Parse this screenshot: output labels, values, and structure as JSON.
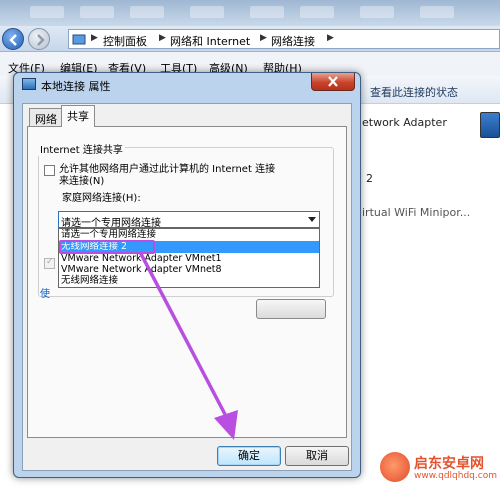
{
  "explorer": {
    "breadcrumbs": [
      "控制面板",
      "网络和 Internet",
      "网络连接"
    ],
    "menu": [
      "文件(F)",
      "编辑(E)",
      "查看(V)",
      "工具(T)",
      "高级(N)",
      "帮助(H)"
    ],
    "toolbar_action": "查看此连接的状态",
    "adapters": [
      {
        "line1": "etwork Adapter",
        "line2": ""
      },
      {
        "line1": "2",
        "line2": ""
      },
      {
        "line1": "irtual WiFi Minipor...",
        "line2": ""
      }
    ]
  },
  "dialog": {
    "title": "本地连接 属性",
    "tabs": [
      "网络",
      "共享"
    ],
    "active_tab": "共享",
    "group_title": "Internet 连接共享",
    "allow_share_line1": "允许其他网络用户通过此计算机的 Internet 连接",
    "allow_share_line2": "来连接(N)",
    "home_network_label": "家庭网络连接(H):",
    "select_value": "请选一个专用网络连接",
    "dropdown_options": [
      "请选一个专用网络连接",
      "无线网络连接 2",
      "VMware Network Adapter VMnet1",
      "VMware Network Adapter VMnet8",
      "无线网络连接"
    ],
    "selected_option_index": 1,
    "link_text": "使",
    "ok_label": "确定",
    "cancel_label": "取消"
  },
  "watermark": {
    "brand": "启东安卓网",
    "url": "www.qdlqhdq.com"
  },
  "colors": {
    "selection": "#3399ff",
    "annotation": "#b84fe0"
  }
}
